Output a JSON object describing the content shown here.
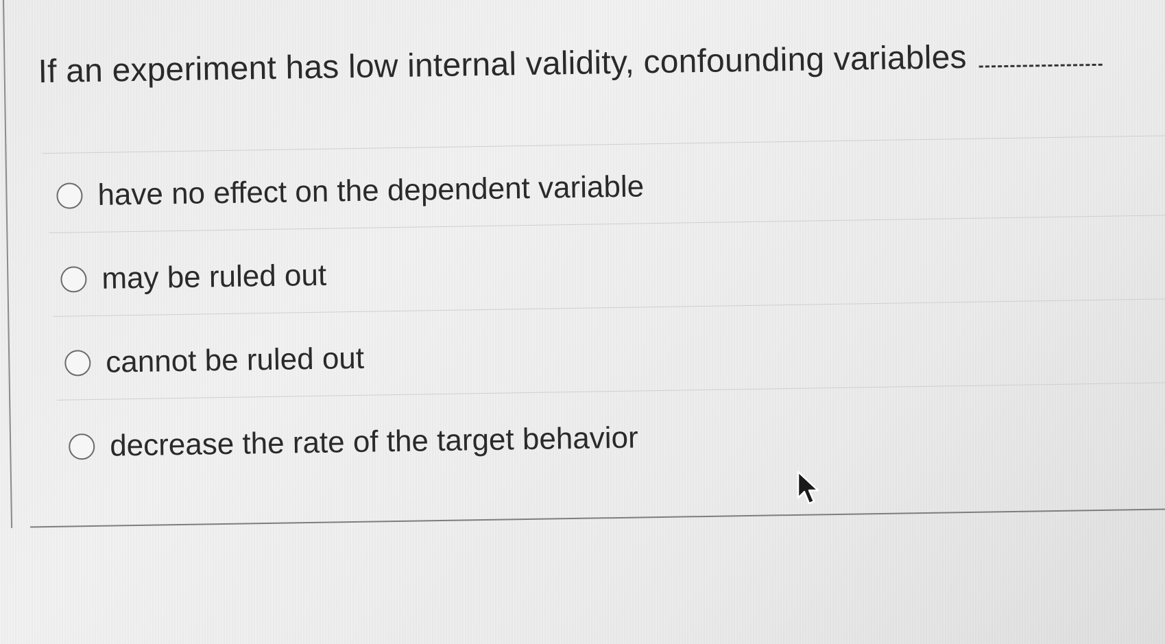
{
  "question": {
    "text": "If an experiment has low internal validity, confounding variables"
  },
  "options": [
    {
      "label": "have no effect on the dependent variable",
      "selected": false
    },
    {
      "label": "may be ruled out",
      "selected": false
    },
    {
      "label": "cannot be ruled out",
      "selected": false
    },
    {
      "label": "decrease the rate of the target behavior",
      "selected": false
    }
  ],
  "colors": {
    "background": "#ececec",
    "text": "#2a2a2a",
    "radio_border": "#6a6a6a",
    "divider": "#cfcfcf"
  },
  "icons": {
    "radio": "radio-unchecked-icon",
    "cursor": "mouse-pointer-icon"
  }
}
